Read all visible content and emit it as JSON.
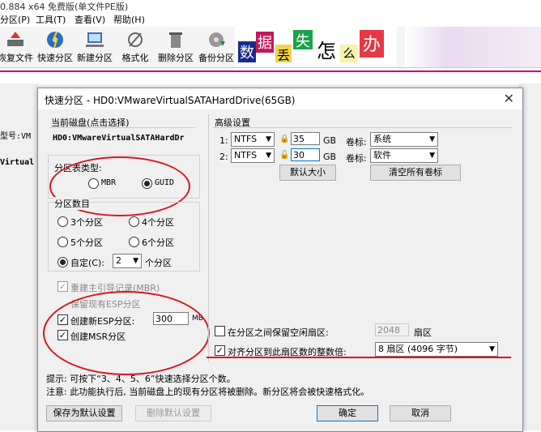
{
  "app": {
    "title": "0.884 x64 免费版(单文件PE版)",
    "menu": [
      "分区(P)",
      "工具(T)",
      "查看(V)",
      "帮助(H)"
    ],
    "toolbar": [
      "恢复文件",
      "快速分区",
      "新建分区",
      "格式化",
      "删除分区",
      "备份分区"
    ],
    "banner": [
      "数",
      "据",
      "丢",
      "失",
      "怎",
      "么",
      "办"
    ],
    "left_fragments": [
      "型号:VM",
      "Virtual"
    ]
  },
  "dialog": {
    "title": "快速分区 - HD0:VMwareVirtualSATAHardDrive(65GB)",
    "current_disk_label": "当前磁盘(点击选择)",
    "current_disk_value": "HD0:VMwareVirtualSATAHardDr",
    "partition_table_label": "分区表类型:",
    "mbr": "MBR",
    "guid": "GUID",
    "partition_count_label": "分区数目",
    "counts": [
      "3个分区",
      "4个分区",
      "5个分区",
      "6个分区"
    ],
    "custom_label": "自定(C):",
    "custom_value": "2",
    "custom_suffix": "个分区",
    "rebuild_mbr": "重建主引导记录(MBR)",
    "keep_esp": "保留现有ESP分区",
    "create_esp": "创建新ESP分区:",
    "esp_size": "300",
    "esp_unit": "MB",
    "create_msr": "创建MSR分区",
    "advanced_label": "高级设置",
    "rows": [
      {
        "index": "1:",
        "fs": "NTFS",
        "size": "35",
        "unit": "GB",
        "vol_label": "卷标:",
        "vol": "系统"
      },
      {
        "index": "2:",
        "fs": "NTFS",
        "size": "30",
        "unit": "GB",
        "vol_label": "卷标:",
        "vol": "软件"
      }
    ],
    "default_size_btn": "默认大小",
    "clear_labels_btn": "清空所有卷标",
    "keep_free_label": "在分区之间保留空闲扇区:",
    "keep_free_value": "2048",
    "keep_free_unit": "扇区",
    "align_label": "对齐分区到此扇区数的整数倍:",
    "align_value": "8 扇区 (4096 字节)",
    "hint": "提示: 可按下“3、4、5、6”快速选择分区个数。",
    "note": "注意: 此功能执行后, 当前磁盘上的现有分区将被删除。新分区将会被快速格式化。",
    "save_default_btn": "保存为默认设置",
    "delete_default_btn": "删除默认设置",
    "ok_btn": "确定",
    "cancel_btn": "取消"
  },
  "colors": {
    "annotation_red": "#d9141e",
    "accent_pink": "#c8006a",
    "focus_blue": "#0078d7"
  }
}
